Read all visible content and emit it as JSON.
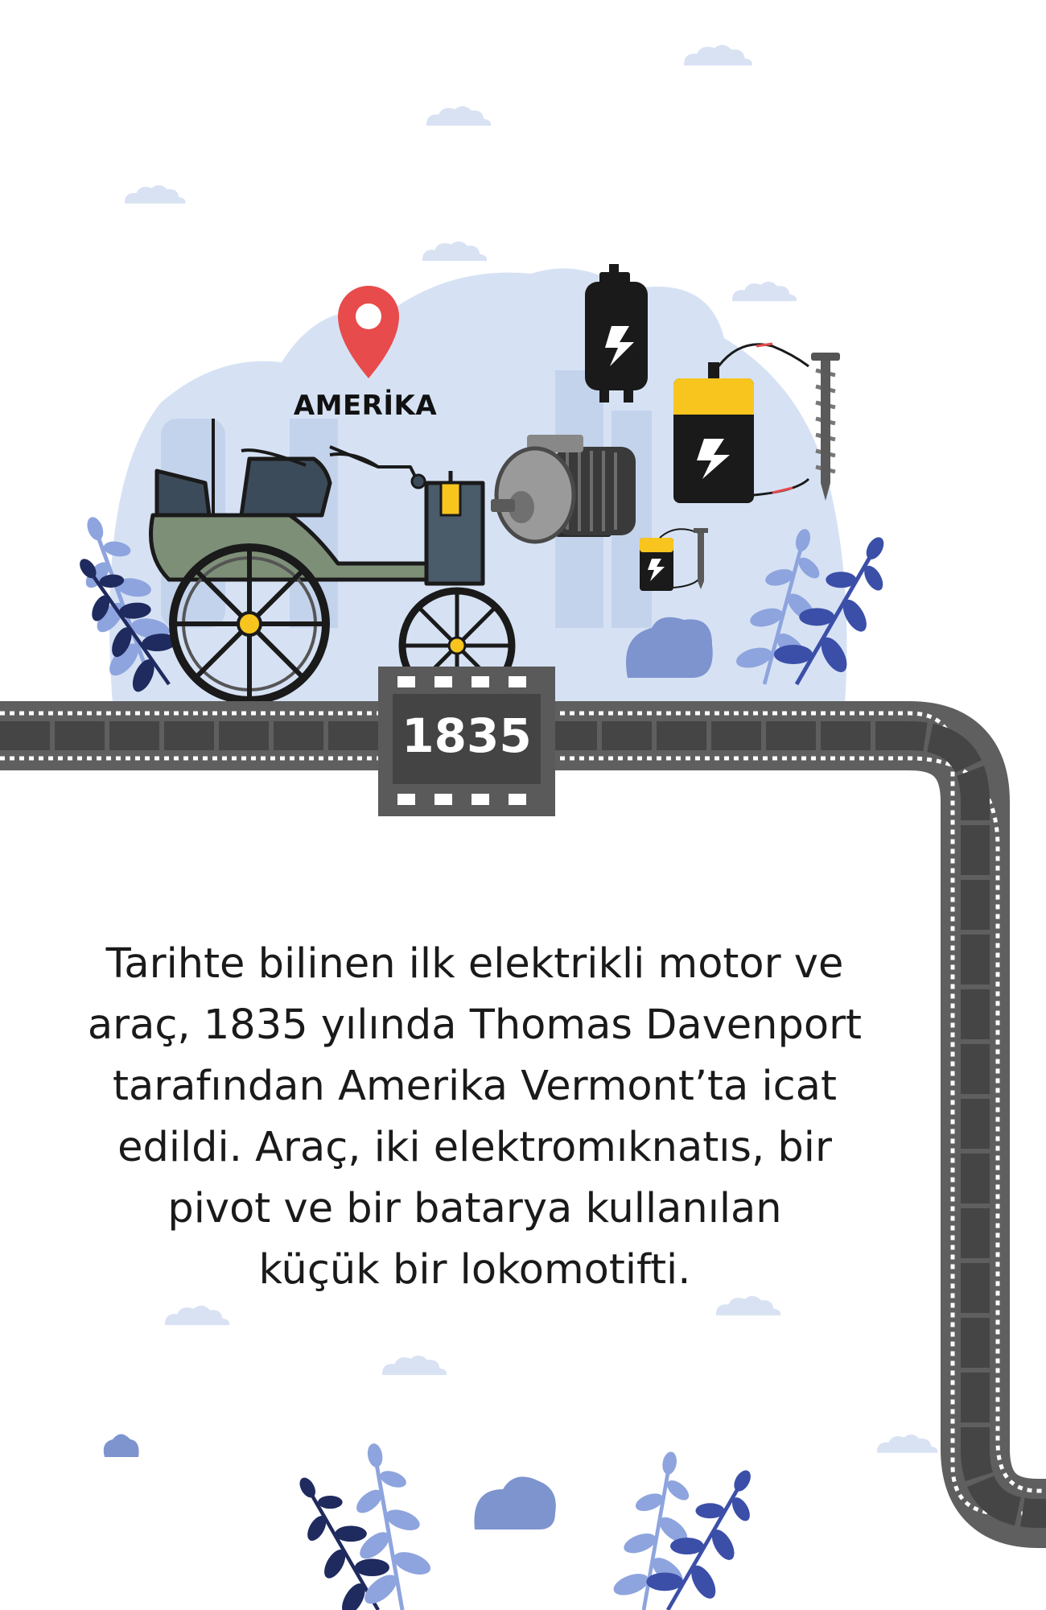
{
  "location": {
    "label": "AMERİKA"
  },
  "timeline": {
    "year": "1835"
  },
  "description": {
    "lines": [
      "Tarihte bilinen ilk elektrikli motor ve",
      "araç, 1835 yılında Thomas Davenport",
      "tarafından Amerika Vermont’ta icat",
      "edildi. Araç, iki elektromıknatıs, bir",
      "pivot ve bir batarya kullanılan",
      "küçük bir lokomotifti."
    ]
  },
  "colors": {
    "sky_blob": "#d6e2f4",
    "film_strip": "#5f5f5f",
    "pin": "#e84b4b",
    "battery_yellow": "#f7c51e",
    "leaf_dark": "#1f2a5e",
    "leaf_mid": "#3b4fa8",
    "leaf_light": "#8ea4de",
    "cloud": "#d9e2f3",
    "bush": "#7d94cf"
  },
  "icons": [
    "location-pin-icon",
    "battery-icon",
    "electric-motor-icon",
    "nail-electromagnet-icon",
    "carriage-illustration"
  ]
}
